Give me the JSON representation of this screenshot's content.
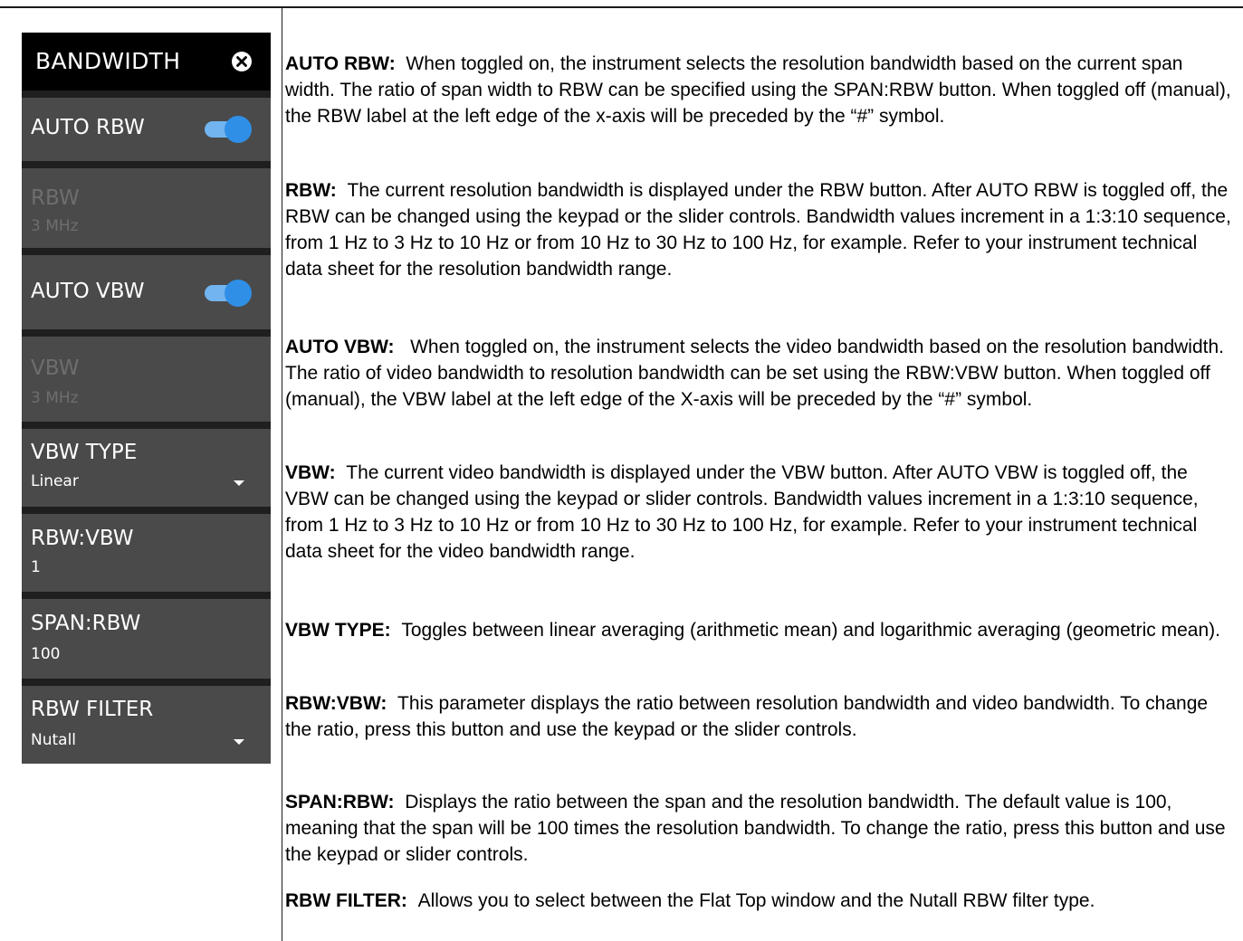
{
  "menu": {
    "title": "BANDWIDTH",
    "items": [
      {
        "label": "AUTO RBW",
        "toggle": "on"
      },
      {
        "label": "RBW",
        "value": "3 MHz",
        "state": "disabled"
      },
      {
        "label": "AUTO VBW",
        "toggle": "on"
      },
      {
        "label": "VBW",
        "value": "3 MHz",
        "state": "disabled"
      },
      {
        "label": "VBW TYPE",
        "value": "Linear"
      },
      {
        "label": "RBW:VBW",
        "value": "1"
      },
      {
        "label": "SPAN:RBW",
        "value": "100"
      },
      {
        "label": "RBW FILTER",
        "value": "Nutall"
      }
    ]
  },
  "descriptions": [
    {
      "term": "AUTO RBW:",
      "text": "When toggled on, the instrument selects the resolution bandwidth based on the current span width. The ratio of span width to RBW can be specified using the SPAN:RBW button. When toggled off (manual), the RBW label at the left edge of the x-axis will be preceded by the “#” symbol."
    },
    {
      "term": "RBW:",
      "text": "The current resolution bandwidth is displayed under the RBW button. After AUTO RBW is toggled off, the RBW can be changed using the keypad or the slider controls. Bandwidth values increment in a 1:3:10 sequence, from 1 Hz to 3 Hz to 10 Hz or from 10 Hz to 30 Hz to 100 Hz, for example. Refer to your instrument technical data sheet for the resolution bandwidth range."
    },
    {
      "term": "AUTO VBW:",
      "text": "When toggled on, the instrument selects the video bandwidth based on the resolution bandwidth. The ratio of video bandwidth to resolution bandwidth can be set using the RBW:VBW button. When toggled off (manual), the VBW label at the left edge of the X-axis will be preceded by the “#” symbol."
    },
    {
      "term": "VBW:",
      "text": "The current video bandwidth is displayed under the VBW button. After AUTO VBW is toggled off, the VBW can be changed using the keypad or slider controls. Bandwidth values increment in a 1:3:10 sequence, from 1 Hz to 3 Hz to 10 Hz or from 10 Hz to 30 Hz to 100 Hz, for example. Refer to your instrument technical data sheet for the video bandwidth range."
    },
    {
      "term": "VBW TYPE:",
      "text": "Toggles between linear averaging (arithmetic mean) and logarithmic averaging (geometric mean)."
    },
    {
      "term": "RBW:VBW:",
      "text": "This parameter displays the ratio between resolution bandwidth and video bandwidth. To change the ratio, press this button and use the keypad or the slider controls."
    },
    {
      "term": "SPAN:RBW:",
      "text": "Displays the ratio between the span and the resolution bandwidth. The default value is 100, meaning that the span will be 100 times the resolution bandwidth. To change the ratio, press this button and use the keypad or slider controls."
    },
    {
      "term": "RBW FILTER:",
      "text": "Allows you to select between the Flat Top window and the Nutall RBW filter type."
    }
  ],
  "colors": {
    "menu_background": "#1f1f1f",
    "menu_header": "#000000",
    "menu_item": "#4a4a4a",
    "toggle_on": "#2f8fe6",
    "disabled_text": "#6e6e6e"
  },
  "icons": [
    "close-icon",
    "chevron-down-icon"
  ]
}
